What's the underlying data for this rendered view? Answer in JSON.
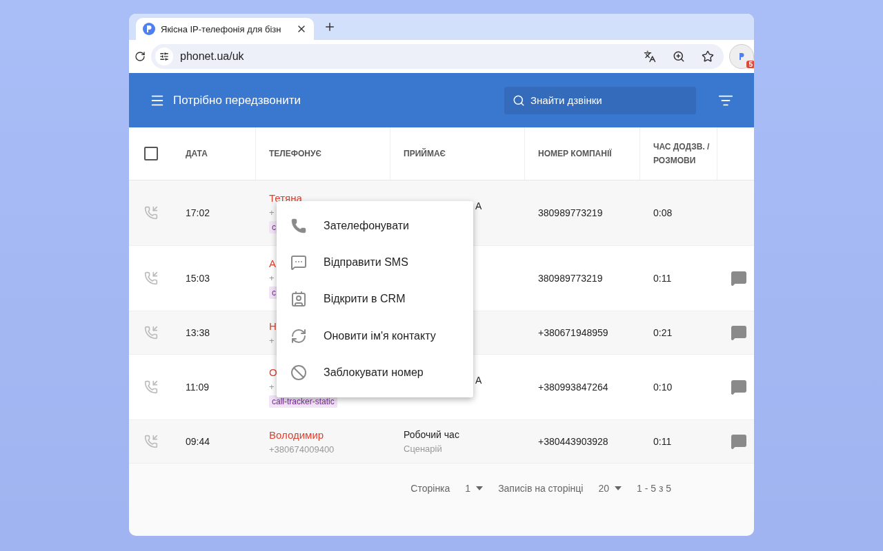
{
  "browser": {
    "tab_title": "Якісна IP-телефонія для бізн",
    "url": "phonet.ua/uk",
    "extension_badge": "5"
  },
  "header": {
    "title": "Потрібно передзвонити",
    "search": {
      "placeholder": "Знайти дзвінки"
    }
  },
  "table": {
    "select_all": {
      "checked": false
    },
    "columns": [
      "ДАТА",
      "ТЕЛЕФОНУЄ",
      "ПРИЙМАЄ",
      "НОМЕР КОМПАНІЇ",
      "ЧАС ДОДЗВ. / РОЗМОВИ"
    ],
    "rows": [
      {
        "time": "17:02",
        "name": "Тетяна",
        "phone": "+",
        "tag": "c",
        "receives": {
          "kind": "fragment",
          "text": "A"
        },
        "company_number": "380989773219",
        "duration": "0:08",
        "comment": false
      },
      {
        "time": "15:03",
        "name": "А",
        "phone": "+",
        "tag": "c",
        "company_number": "380989773219",
        "duration": "0:11",
        "comment": true
      },
      {
        "time": "13:38",
        "name": "Н",
        "phone": "+",
        "company_number": "+380671948959",
        "duration": "0:21",
        "comment": true
      },
      {
        "time": "11:09",
        "name": "О",
        "phone": "+",
        "tag": "call-tracker-static",
        "receives": {
          "kind": "fragment",
          "text": "A"
        },
        "company_number": "+380993847264",
        "duration": "0:10",
        "comment": true
      },
      {
        "time": "09:44",
        "name": "Володимир",
        "phone": "+380674009400",
        "receives": {
          "kind": "full",
          "text": "Робочий час",
          "sub": "Сценарій"
        },
        "company_number": "+380443903928",
        "duration": "0:11",
        "comment": true
      }
    ]
  },
  "context_menu": {
    "items": [
      {
        "kind": "call",
        "label": "Зателефонувати"
      },
      {
        "kind": "sms",
        "label": "Відправити SMS"
      },
      {
        "kind": "crm",
        "label": "Відкрити в CRM"
      },
      {
        "kind": "refresh",
        "label": "Оновити ім'я контакту"
      },
      {
        "kind": "block",
        "label": "Заблокувати номер"
      }
    ]
  },
  "pagination": {
    "page_label": "Сторінка",
    "page": "1",
    "per_page_label": "Записів на сторінці",
    "per_page": "20",
    "range": "1 - 5 з 5"
  }
}
